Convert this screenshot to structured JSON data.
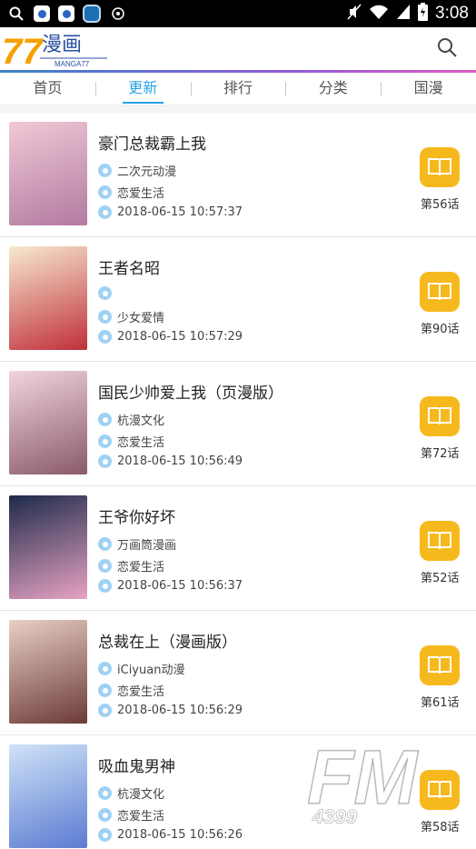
{
  "status_bar": {
    "time": "3:08",
    "left_icons": [
      "search-icon",
      "paw-icon",
      "paw-icon",
      "app-icon",
      "settings-icon"
    ],
    "right_icons": [
      "mute-icon",
      "wifi-icon",
      "signal-icon",
      "battery-icon"
    ]
  },
  "header": {
    "logo_text": "漫画",
    "logo_sub": "MANGA77",
    "logo_mark": "77"
  },
  "tabs": [
    {
      "label": "首页",
      "active": false
    },
    {
      "label": "更新",
      "active": true
    },
    {
      "label": "排行",
      "active": false
    },
    {
      "label": "分类",
      "active": false
    },
    {
      "label": "国漫",
      "active": false
    }
  ],
  "items": [
    {
      "title": "豪门总裁霸上我",
      "author": "二次元动漫",
      "genre": "恋爱生活",
      "time": "2018-06-15 10:57:37",
      "chapter": "第56话",
      "cover_colors": [
        "#f0c9d6",
        "#b27aa0"
      ]
    },
    {
      "title": "王者名昭",
      "author": "",
      "genre": "少女爱情",
      "time": "2018-06-15 10:57:29",
      "chapter": "第90话",
      "cover_colors": [
        "#f7e9d0",
        "#c0303a"
      ]
    },
    {
      "title": "国民少帅爱上我（页漫版）",
      "author": "杭漫文化",
      "genre": "恋爱生活",
      "time": "2018-06-15 10:56:49",
      "chapter": "第72话",
      "cover_colors": [
        "#f1d4dc",
        "#8a5a6a"
      ]
    },
    {
      "title": "王爷你好坏",
      "author": "万画筒漫画",
      "genre": "恋爱生活",
      "time": "2018-06-15 10:56:37",
      "chapter": "第52话",
      "cover_colors": [
        "#1e2a4a",
        "#e7a3c3"
      ]
    },
    {
      "title": "总裁在上（漫画版）",
      "author": "iCiyuan动漫",
      "genre": "恋爱生活",
      "time": "2018-06-15 10:56:29",
      "chapter": "第61话",
      "cover_colors": [
        "#e9cfc6",
        "#6b3a3a"
      ]
    },
    {
      "title": "吸血鬼男神",
      "author": "杭漫文化",
      "genre": "恋爱生活",
      "time": "2018-06-15 10:56:26",
      "chapter": "第58话",
      "cover_colors": [
        "#cfe3f7",
        "#5b7bd1"
      ]
    }
  ],
  "watermark": {
    "text": "FM",
    "sub": "4399"
  },
  "colors": {
    "accent": "#29a1e6",
    "button": "#f6b91d",
    "meta_icon": "#9fd1f4"
  }
}
